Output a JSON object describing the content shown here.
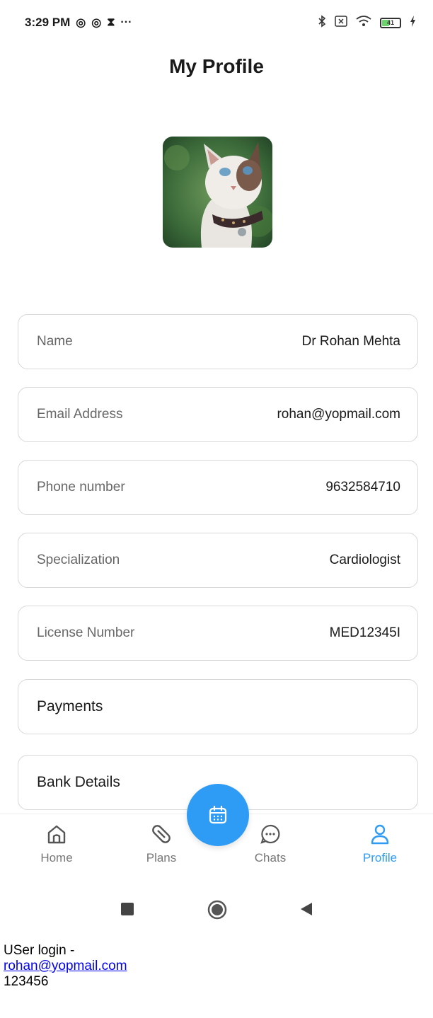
{
  "status_bar": {
    "time": "3:29 PM",
    "left_glyphs": [
      "◎",
      "◎",
      "⧗",
      "···"
    ],
    "battery_level": "41",
    "icons": [
      "bluetooth-icon",
      "sim-icon",
      "wifi-icon",
      "battery-icon",
      "charging-icon"
    ]
  },
  "header": {
    "title": "My Profile"
  },
  "profile": {
    "avatar_icon": "cat-photo",
    "fields": [
      {
        "label": "Name",
        "value": "Dr Rohan Mehta"
      },
      {
        "label": "Email Address",
        "value": "rohan@yopmail.com"
      },
      {
        "label": "Phone number",
        "value": "9632584710"
      },
      {
        "label": "Specialization",
        "value": "Cardiologist"
      },
      {
        "label": "License Number",
        "value": "MED12345I"
      }
    ],
    "links": [
      {
        "label": "Payments"
      },
      {
        "label": "Bank Details"
      }
    ]
  },
  "fab": {
    "icon": "calendar-icon"
  },
  "bottom_nav": {
    "items": [
      {
        "label": "Home",
        "icon": "home-icon",
        "active": false
      },
      {
        "label": "Plans",
        "icon": "pill-icon",
        "active": false
      },
      {
        "label": "Chats",
        "icon": "chat-icon",
        "active": false
      },
      {
        "label": "Profile",
        "icon": "user-icon",
        "active": true
      }
    ]
  },
  "system_nav": {
    "icons": [
      "recents-square-icon",
      "home-circle-icon",
      "back-triangle-icon"
    ]
  },
  "note": {
    "line1": "USer login -",
    "email_link": "rohan@yopmail.com",
    "password": "123456"
  },
  "colors": {
    "accent": "#2e9bf5",
    "border": "#d8d8d8",
    "text": "#1a1a1a",
    "muted": "#777777"
  }
}
